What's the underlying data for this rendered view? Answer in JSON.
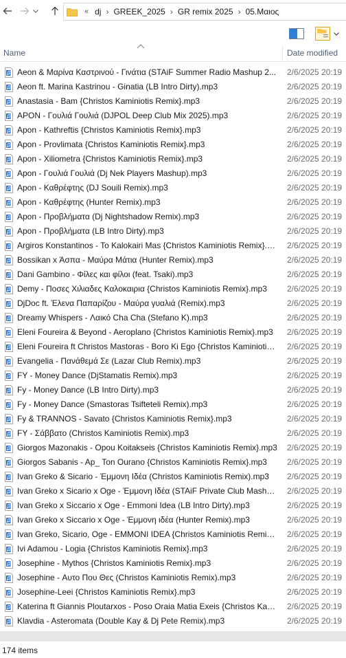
{
  "address": {
    "overflow_label": "«",
    "breadcrumbs": [
      "dj",
      "GREEK_2025",
      "GR remix 2025",
      "05.Μαιος"
    ]
  },
  "header": {
    "name_label": "Name",
    "date_label": "Date modified"
  },
  "files": [
    {
      "name": "Aeon & Μαρίνα Καστρινού - Γινάτια (STAiF Summer Radio Mashup 2...",
      "date": "2/6/2025 20:19"
    },
    {
      "name": "Aeon ft. Marina Kastrinou - Ginatia (LB Intro Dirty).mp3",
      "date": "2/6/2025 20:19"
    },
    {
      "name": "Anastasia - Bam {Christos Kaminiotis Remix}.mp3",
      "date": "2/6/2025 20:19"
    },
    {
      "name": "APON  - Γουλιά Γουλιά (DJPOL Deep Club Mix 2025).mp3",
      "date": "2/6/2025 20:19"
    },
    {
      "name": "Apon - Kathreftis {Christos Kaminiotis Remix}.mp3",
      "date": "2/6/2025 20:19"
    },
    {
      "name": "Apon - Provlimata {Christos Kaminiotis Remix}.mp3",
      "date": "2/6/2025 20:19"
    },
    {
      "name": "Apon - Xiliometra {Christos Kaminiotis Remix}.mp3",
      "date": "2/6/2025 20:19"
    },
    {
      "name": "Apon - Γουλιά Γουλιά (Dj Nek Players Mashup).mp3",
      "date": "2/6/2025 20:19"
    },
    {
      "name": "Apon - Καθρέφτης (DJ Souili Remix).mp3",
      "date": "2/6/2025 20:19"
    },
    {
      "name": "Apon - Καθρέφτης (Hunter Remix).mp3",
      "date": "2/6/2025 20:19"
    },
    {
      "name": "Apon - Προβλήματα (Dj Nightshadow Remix).mp3",
      "date": "2/6/2025 20:19"
    },
    {
      "name": "Apon - Προβλήματα (LB Intro Dirty).mp3",
      "date": "2/6/2025 20:19"
    },
    {
      "name": "Argiros Konstantinos - To Kalokairi Mas {Christos Kaminiotis Remix}.m...",
      "date": "2/6/2025 20:19"
    },
    {
      "name": "Bossikan x Άσπα - Μαύρα Μάτια (Hunter Remix).mp3",
      "date": "2/6/2025 20:19"
    },
    {
      "name": "Dani Gambino - Φίλες και φίλοι (feat. Tsaki).mp3",
      "date": "2/6/2025 20:19"
    },
    {
      "name": "Demy - Ποσες Χιλιαδες Καλοκαιρια {Christos Kaminiotis Remix}.mp3",
      "date": "2/6/2025 20:19"
    },
    {
      "name": "DjDoc ft. Έλενα Παπαρίζου - Μαύρα γυαλιά (Remix).mp3",
      "date": "2/6/2025 20:19"
    },
    {
      "name": "Dreamy Whispers - Λαικό Cha Cha (Stefano K).mp3",
      "date": "2/6/2025 20:19"
    },
    {
      "name": "Eleni Foureira & Beyond - Aeroplano {Christos Kaminiotis Remix}.mp3",
      "date": "2/6/2025 20:19"
    },
    {
      "name": "Eleni Foureira ft Christos Mastoras - Boro Ki Ego {Christos Kaminiotis R...",
      "date": "2/6/2025 20:19"
    },
    {
      "name": "Evangelia - Πανάθεμά Σε (Lazar Club Remix).mp3",
      "date": "2/6/2025 20:19"
    },
    {
      "name": "FY - Money Dance (DjStamatis Remix).mp3",
      "date": "2/6/2025 20:19"
    },
    {
      "name": "Fy - Money Dance (LB Intro Dirty).mp3",
      "date": "2/6/2025 20:19"
    },
    {
      "name": "Fy - Money Dance (Smastoras Tsifteteli Remix).mp3",
      "date": "2/6/2025 20:19"
    },
    {
      "name": "Fy & TRANNOS - Savato {Christos Kaminiotis Remix}.mp3",
      "date": "2/6/2025 20:19"
    },
    {
      "name": "FY - Σάββατο (Christos Kaminiotis Remix).mp3",
      "date": "2/6/2025 20:19"
    },
    {
      "name": "Giorgos Mazonakis - Opou Koitakseis {Christos Kaminiotis Remix}.mp3",
      "date": "2/6/2025 20:19"
    },
    {
      "name": "Giorgos Sabanis - Ap_ Ton Ourano {Christos Kaminiotis Remix}.mp3",
      "date": "2/6/2025 20:19"
    },
    {
      "name": "Ivan Greko & Sicario - Έμμονη Ιδέα (Christos Kaminiotis Remix).mp3",
      "date": "2/6/2025 20:19"
    },
    {
      "name": "Ivan Greko x Sicario x Oge - Έμμονη Ιδέα (STAiF Private Club Mashup ...",
      "date": "2/6/2025 20:19"
    },
    {
      "name": "Ivan Greko x Siccario x Oge - Emmoni Idea (LB Intro Dirty).mp3",
      "date": "2/6/2025 20:19"
    },
    {
      "name": "Ivan Greko x Siccario x Oge - Έμμονη ιδέα (Hunter Remix).mp3",
      "date": "2/6/2025 20:19"
    },
    {
      "name": "Ivan Greko, Sicario, Oge - EMMONI IDEA {Christos Kaminiotis Remix}....",
      "date": "2/6/2025 20:19"
    },
    {
      "name": "Ivi Adamou - Logia {Christos Kaminiotis Remix}.mp3",
      "date": "2/6/2025 20:19"
    },
    {
      "name": "Josephine - Mythos {Christos Kaminiotis Remix}.mp3",
      "date": "2/6/2025 20:19"
    },
    {
      "name": "Josephine - Αυτο Που Θες (Christos Kaminiotis Remix).mp3",
      "date": "2/6/2025 20:19"
    },
    {
      "name": "Josephine-Leei {Christos Kaminiotis Remix}.mp3",
      "date": "2/6/2025 20:19"
    },
    {
      "name": "Katerina ft Giannis Ploutarxos - Poso Oraia Matia Exeis {Christos Kami...",
      "date": "2/6/2025 20:19"
    },
    {
      "name": "Klavdia - Asteromata (Double Kay & Dj Pete Remix).mp3",
      "date": "2/6/2025 20:19"
    }
  ],
  "status": {
    "item_count": "174 items"
  },
  "colors": {
    "folder": "#f4c44d",
    "file_icon_blue": "#2a6fc9",
    "header_text": "#4c607a"
  }
}
